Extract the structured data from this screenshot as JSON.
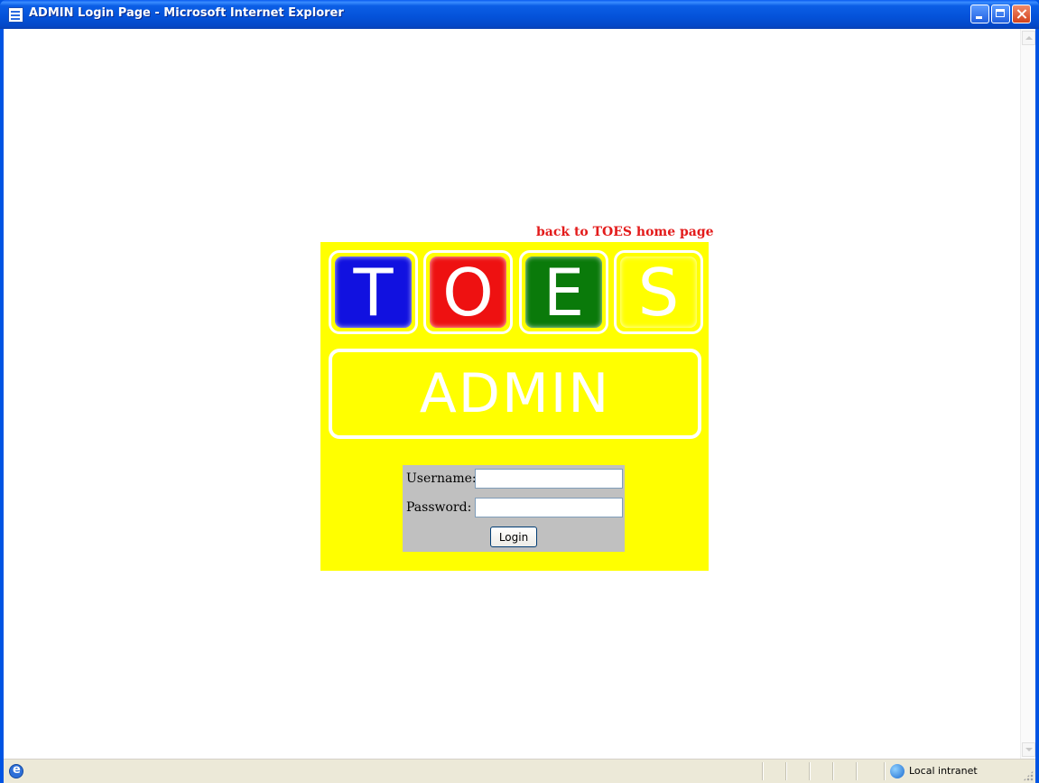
{
  "window": {
    "title": "ADMIN Login Page - Microsoft Internet Explorer"
  },
  "page": {
    "back_link": "back to TOES home page",
    "logo": {
      "tiles": [
        {
          "letter": "T",
          "color": "#1111e0"
        },
        {
          "letter": "O",
          "color": "#ee1111"
        },
        {
          "letter": "E",
          "color": "#0a7a0a"
        },
        {
          "letter": "S",
          "color": "#ffff00"
        }
      ],
      "banner": "ADMIN"
    },
    "login": {
      "username_label": "Username:",
      "username_value": "",
      "password_label": "Password:",
      "password_value": "",
      "submit_label": "Login"
    },
    "background_color": "#ffff00"
  },
  "statusbar": {
    "zone": "Local intranet"
  }
}
